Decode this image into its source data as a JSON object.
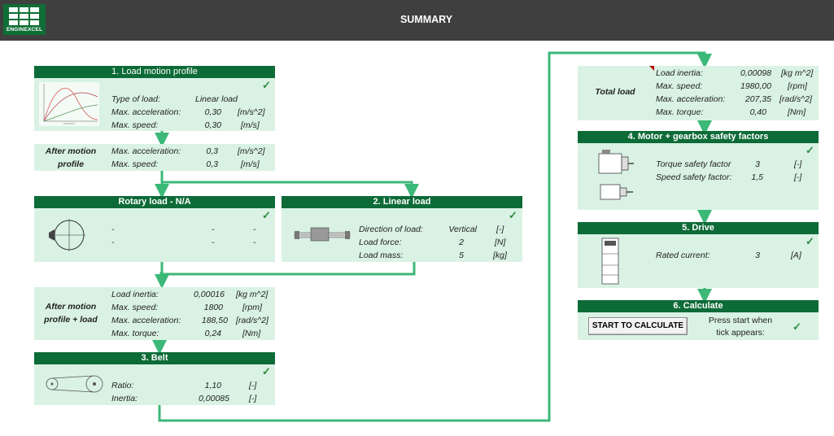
{
  "header": {
    "title": "SUMMARY",
    "logo_text": "ENGINEXCEL"
  },
  "colors": {
    "accent": "#0d6b37",
    "panel": "#d9f2e4",
    "connector": "#3cb878",
    "topbar": "#3f3f3f",
    "tick": "#2e8b3e"
  },
  "icons": {
    "tick": "check-icon"
  },
  "load_motion": {
    "title": "1. Load motion profile",
    "tick": "✓",
    "type_label": "Type of load:",
    "type_value": "Linear load",
    "acc_label": "Max. acceleration:",
    "acc_value": "0,30",
    "acc_unit": "[m/s^2]",
    "speed_label": "Max. speed:",
    "speed_value": "0,30",
    "speed_unit": "[m/s]"
  },
  "after_motion": {
    "label_line1": "After motion",
    "label_line2": "profile",
    "acc_label": "Max. acceleration:",
    "acc_value": "0,3",
    "acc_unit": "[m/s^2]",
    "speed_label": "Max. speed:",
    "speed_value": "0,3",
    "speed_unit": "[m/s]"
  },
  "rotary": {
    "title": "Rotary load - N/A",
    "tick": "✓",
    "rows": [
      [
        "-",
        "-",
        "-"
      ],
      [
        "-",
        "-",
        "-"
      ]
    ]
  },
  "linear": {
    "title": "2. Linear load",
    "tick": "✓",
    "dir_label": "Direction of load:",
    "dir_value": "Vertical",
    "dir_unit": "[-]",
    "force_label": "Load force:",
    "force_value": "2",
    "force_unit": "[N]",
    "mass_label": "Load mass:",
    "mass_value": "5",
    "mass_unit": "[kg]"
  },
  "after_load": {
    "label_line1": "After motion",
    "label_line2": "profile + load",
    "inertia_label": "Load inertia:",
    "inertia_value": "0,00016",
    "inertia_unit": "[kg m^2]",
    "speed_label": "Max. speed:",
    "speed_value": "1800",
    "speed_unit": "[rpm]",
    "acc_label": "Max. acceleration:",
    "acc_value": "188,50",
    "acc_unit": "[rad/s^2]",
    "torque_label": "Max. torque:",
    "torque_value": "0,24",
    "torque_unit": "[Nm]"
  },
  "belt": {
    "title": "3. Belt",
    "tick": "✓",
    "ratio_label": "Ratio:",
    "ratio_value": "1,10",
    "ratio_unit": "[-]",
    "inertia_label": "Inertia:",
    "inertia_value": "0,00085",
    "inertia_unit": "[-]"
  },
  "total_load": {
    "label": "Total load",
    "inertia_label": "Load inertia:",
    "inertia_value": "0,00098",
    "inertia_unit": "[kg m^2]",
    "speed_label": "Max. speed:",
    "speed_value": "1980,00",
    "speed_unit": "[rpm]",
    "acc_label": "Max. acceleration:",
    "acc_value": "207,35",
    "acc_unit": "[rad/s^2]",
    "torque_label": "Max. torque:",
    "torque_value": "0,40",
    "torque_unit": "[Nm]"
  },
  "safety": {
    "title": "4. Motor + gearbox safety factors",
    "tick": "✓",
    "torque_label": "Torque safety factor",
    "torque_value": "3",
    "torque_unit": "[-]",
    "speed_label": "Speed safety factor:",
    "speed_value": "1,5",
    "speed_unit": "[-]"
  },
  "drive": {
    "title": "5. Drive",
    "tick": "✓",
    "current_label": "Rated current:",
    "current_value": "3",
    "current_unit": "[A]"
  },
  "calculate": {
    "title": "6. Calculate",
    "button_label": "START TO CALCULATE",
    "hint_line1": "Press start when",
    "hint_line2": "tick appears:",
    "tick": "✓"
  }
}
